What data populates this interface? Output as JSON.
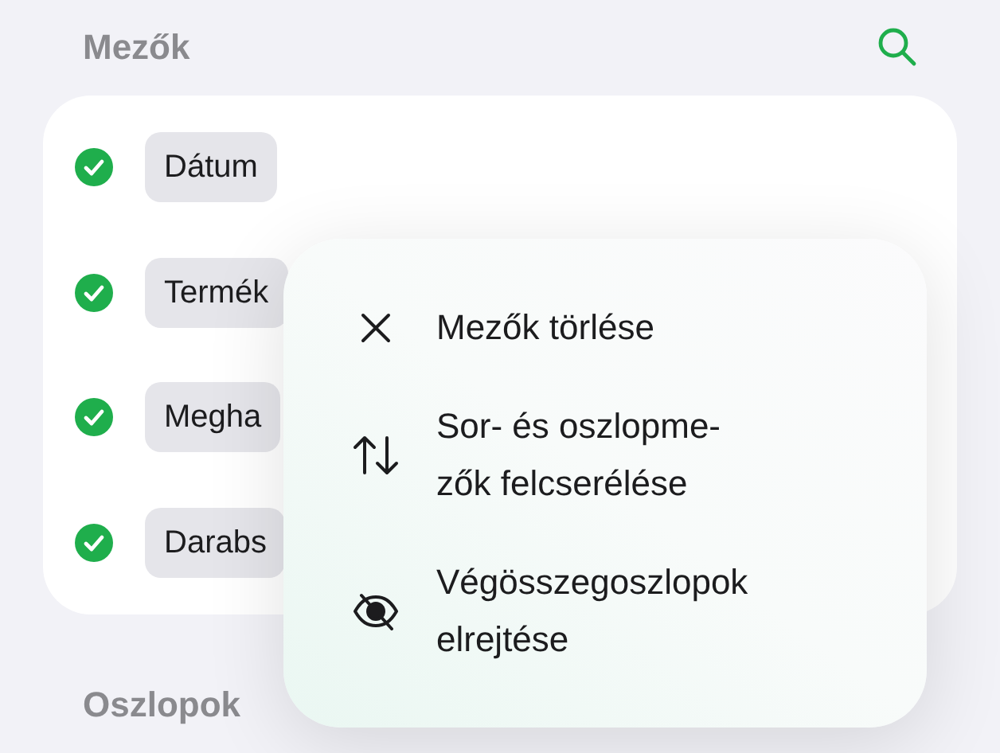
{
  "section_title": "Mezők",
  "fields": [
    {
      "label": "Dátum",
      "checked": true
    },
    {
      "label": "Termék",
      "checked": true
    },
    {
      "label": "Megha",
      "checked": true
    },
    {
      "label": "Darabs",
      "checked": true
    }
  ],
  "menu": {
    "items": [
      {
        "kind": "clear",
        "lines": [
          "Mezők törlése"
        ]
      },
      {
        "kind": "swap",
        "lines": [
          "Sor- és oszlopme-",
          "zők felcserélése"
        ]
      },
      {
        "kind": "hide",
        "lines": [
          "Végösszegoszlopok",
          "elrejtése"
        ]
      }
    ]
  },
  "next_section_title": "Oszlopok"
}
